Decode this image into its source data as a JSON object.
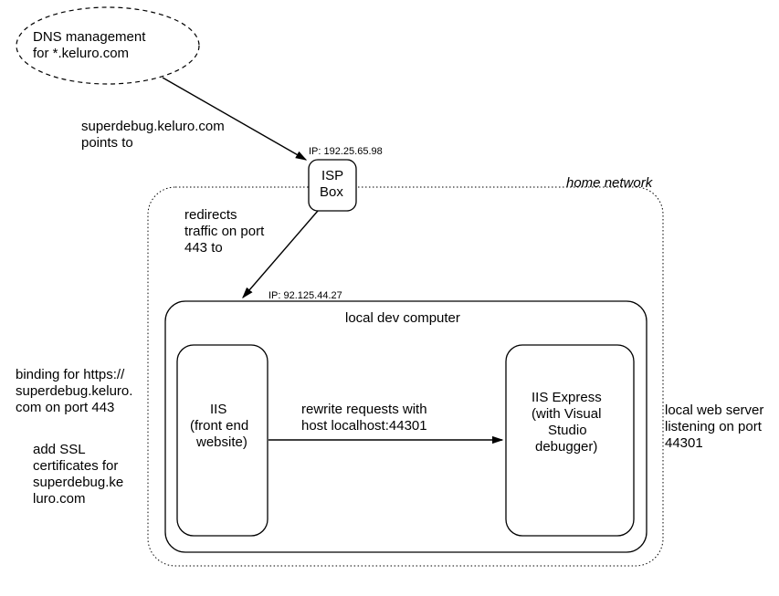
{
  "dns": {
    "title_line1": "DNS management",
    "title_line2": "for *.keluro.com"
  },
  "arrows": {
    "dns_to_isp_line1": "superdebug.keluro.com",
    "dns_to_isp_line2": "points to",
    "isp_to_dev_line1": "redirects",
    "isp_to_dev_line2": "traffic on port",
    "isp_to_dev_line3": "443 to",
    "iis_to_express_line1": "rewrite requests with",
    "iis_to_express_line2": "host localhost:44301"
  },
  "isp": {
    "ip_label": "IP: 192.25.65.98",
    "line1": "ISP",
    "line2": "Box"
  },
  "home_network_label": "home network",
  "dev": {
    "ip_label": "IP: 92.125.44.27",
    "title": "local dev computer"
  },
  "iis": {
    "line1": "IIS",
    "line2": "(front end",
    "line3": "website)"
  },
  "iis_express": {
    "line1": "IIS Express",
    "line2": "(with Visual",
    "line3": "Studio",
    "line4": "debugger)"
  },
  "side_left": {
    "binding_line1": "binding for https://",
    "binding_line2": "superdebug.keluro.",
    "binding_line3": "com on port 443",
    "ssl_line1": "add SSL",
    "ssl_line2": "certificates for",
    "ssl_line3": "superdebug.ke",
    "ssl_line4": "luro.com"
  },
  "side_right": {
    "line1": "local web server",
    "line2": "listening on port",
    "line3": "44301"
  }
}
